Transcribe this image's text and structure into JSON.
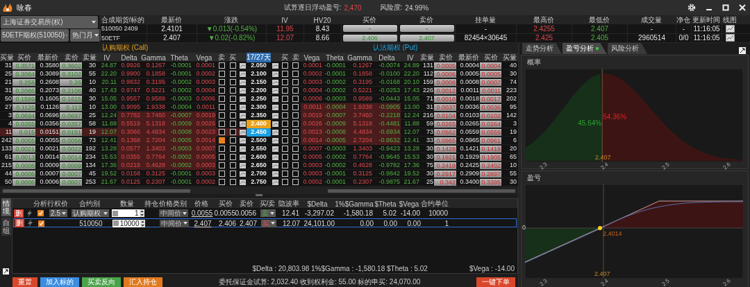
{
  "title_bar": {
    "app_name": "咏春",
    "pnl_label": "试算逐日浮动盈亏:",
    "pnl_value": "2,470",
    "risk_label": "风险度:",
    "risk_value": "24.99%"
  },
  "selectors": {
    "exchange": "上海证券交易所(权)",
    "product": "50ETF期权(510050)",
    "month": "热门月"
  },
  "quote": {
    "columns": [
      "合成期货/标的",
      "最新价",
      "涨跌",
      "IV",
      "HV20",
      "买价",
      "卖价",
      "挂单量",
      "最高价",
      "最低价",
      "成交量",
      "净仓",
      "更新时间",
      "线图"
    ],
    "rows": [
      {
        "name": "510050 2409",
        "last": "2.4101",
        "change": "▼0.013(-0.54%)",
        "iv": "11.95",
        "hv20": "8.43",
        "bid": "-",
        "ask": "-",
        "depth": "-",
        "high": "2.4255",
        "low": "2.407",
        "volume": "-",
        "net": "-",
        "time": "11:16:05"
      },
      {
        "name": "50ETF",
        "last": "2.407",
        "change": "▼0.02(-0.82%)",
        "iv": "12.07",
        "hv20": "8.66",
        "bid": "2.406",
        "ask": "2.407",
        "depth": "82454×30645",
        "high": "2.425",
        "low": "2.405",
        "volume": "2960514",
        "net": "0/0",
        "time": "11:16:05"
      }
    ]
  },
  "chain": {
    "call_title": "认购期权 (Call)",
    "put_title": "认沽期权 (Put)",
    "call_columns": [
      "买量",
      "买价",
      "最新价",
      "卖价",
      "卖量",
      "IV",
      "Delta",
      "Gamma",
      "Theta",
      "Vega",
      "卖",
      "买"
    ],
    "strike_column": "17/27天",
    "put_columns": [
      "买",
      "卖",
      "Vega",
      "Theta",
      "Gamma",
      "Delta",
      "IV",
      "卖量",
      "卖价",
      "最新价",
      "买价",
      "买量"
    ],
    "rows": [
      {
        "strike": "2.050",
        "atm": false,
        "selected": false,
        "call_shaded": false,
        "put_shaded": false,
        "call_sell": false,
        "call_buy": false,
        "put_buy": false,
        "put_sell": false,
        "call": [
          "31",
          "0.3571",
          "0.3580",
          "0.3602",
          "30",
          "24.87",
          "0.9926",
          "0.1267",
          "-0.0001",
          "0.0001"
        ],
        "put": [
          "0.0001",
          "-0.0001",
          "0.1267",
          "-0.0074",
          "24.89",
          "131",
          "0.0005",
          "0.0004",
          "0.0004",
          "40"
        ]
      },
      {
        "strike": "2.100",
        "atm": false,
        "selected": false,
        "call_shaded": false,
        "put_shaded": false,
        "call_sell": false,
        "call_buy": false,
        "put_buy": false,
        "put_sell": false,
        "call": [
          "25",
          "0.3084",
          "0.3089",
          "0.3102",
          "55",
          "22.20",
          "0.9900",
          "0.1858",
          "-0.0001",
          "0.0002"
        ],
        "put": [
          "0.0002",
          "-0.0001",
          "0.1858",
          "-0.0100",
          "22.20",
          "112",
          "0.0006",
          "0.0005",
          "0.0005",
          "30"
        ]
      },
      {
        "strike": "2.150",
        "atm": false,
        "selected": false,
        "call_shaded": false,
        "put_shaded": false,
        "call_sell": false,
        "call_buy": false,
        "put_buy": false,
        "put_sell": false,
        "call": [
          "21",
          "0.258",
          "0.2608",
          "0.26",
          "10",
          "20.11",
          "0.9832",
          "0.3195",
          "-0.0002",
          "0.0003"
        ],
        "put": [
          "0.0003",
          "-0.0002",
          "0.3195",
          "-0.0168",
          "20.10",
          "159",
          "0.0008",
          "0.0008",
          "0.0007",
          "74"
        ]
      },
      {
        "strike": "2.200",
        "atm": false,
        "selected": false,
        "call_shaded": false,
        "put_shaded": false,
        "call_sell": false,
        "call_buy": false,
        "put_buy": false,
        "put_sell": false,
        "call": [
          "31",
          "0.2086",
          "0.2073",
          "0.2108",
          "40",
          "17.43",
          "0.9747",
          "0.5221",
          "-0.0002",
          "0.0004"
        ],
        "put": [
          "0.0004",
          "-0.0002",
          "0.5221",
          "-0.0253",
          "17.43",
          "226",
          "0.0012",
          "0.0011",
          "0.0011",
          "223"
        ]
      },
      {
        "strike": "2.250",
        "atm": false,
        "selected": false,
        "call_shaded": false,
        "put_shaded": false,
        "call_sell": false,
        "call_buy": false,
        "put_buy": false,
        "put_sell": false,
        "call": [
          "50",
          "0.1599",
          "0.1605",
          "0.1615",
          "30",
          "15.05",
          "0.9557",
          "0.9589",
          "-0.0003",
          "0.0006"
        ],
        "put": [
          "0.0006",
          "-0.0003",
          "0.9589",
          "-0.0443",
          "15.05",
          "71",
          "0.0018",
          "0.0018",
          "0.0017",
          "202"
        ]
      },
      {
        "strike": "2.300",
        "atm": false,
        "selected": false,
        "call_shaded": false,
        "put_shaded": true,
        "call_sell": false,
        "call_buy": false,
        "put_buy": false,
        "put_sell": false,
        "call": [
          "27",
          "0.1126",
          "0.1126",
          "0.113",
          "10",
          "13.00",
          "0.9095",
          "1.9338",
          "-0.0004",
          "0.0011"
        ],
        "put": [
          "0.0011",
          "-0.0004",
          "1.9338",
          "-0.0905",
          "13.00",
          "31",
          "0.0037",
          "0.0036",
          "0.0036",
          "95"
        ]
      },
      {
        "strike": "2.350",
        "atm": false,
        "selected": false,
        "call_shaded": true,
        "put_shaded": true,
        "call_sell": false,
        "call_buy": false,
        "put_buy": false,
        "put_sell": false,
        "call": [
          "3",
          "0.0694",
          "0.0696",
          "0.0697",
          "25",
          "12.24",
          "0.7782",
          "3.7460",
          "-0.0007",
          "0.0019"
        ],
        "put": [
          "0.0019",
          "-0.0007",
          "3.7460",
          "-0.2218",
          "12.24",
          "216",
          "0.0104",
          "0.0103",
          "0.0102",
          "142"
        ]
      },
      {
        "strike": "2.400",
        "atm": true,
        "selected": false,
        "call_shaded": true,
        "put_shaded": true,
        "call_sell": false,
        "call_buy": false,
        "put_buy": false,
        "put_sell": false,
        "call": [
          "4",
          "0.0355",
          "0.0356",
          "0.0357",
          "58",
          "11.88",
          "0.5519",
          "5.1318",
          "-0.0009",
          "0.0026"
        ],
        "put": [
          "0.0026",
          "-0.0009",
          "5.1318",
          "-0.4481",
          "11.88",
          "59",
          "0.0265",
          "0.0265",
          "0.0264",
          "3"
        ]
      },
      {
        "strike": "2.450",
        "atm": false,
        "selected": true,
        "call_shaded": true,
        "put_shaded": true,
        "call_sell": false,
        "call_buy": false,
        "put_buy": false,
        "put_sell": false,
        "call": [
          "11",
          "0.015",
          "0.0151",
          "0.0151",
          "19",
          "12.07",
          "0.3066",
          "4.4834",
          "-0.0008",
          "0.0023"
        ],
        "put": [
          "0.0023",
          "-0.0008",
          "4.4834",
          "-0.6934",
          "12.07",
          "73",
          "0.0562",
          "0.0559",
          "0.0559",
          "19"
        ]
      },
      {
        "strike": "2.500",
        "atm": false,
        "selected": false,
        "call_shaded": true,
        "put_shaded": true,
        "call_sell": true,
        "call_buy": false,
        "put_buy": false,
        "put_sell": false,
        "call": [
          "242",
          "0.0055",
          "0.0055",
          "0.0056",
          "73",
          "12.41",
          "0.1368",
          "2.7204",
          "-0.0005",
          "0.0014"
        ],
        "put": [
          "0.0014",
          "-0.0005",
          "2.7204",
          "-0.8632",
          "12.41",
          "33",
          "0.0965",
          "0.0965",
          "0.0961",
          "6"
        ]
      },
      {
        "strike": "2.550",
        "atm": false,
        "selected": false,
        "call_shaded": true,
        "put_shaded": false,
        "call_sell": false,
        "call_buy": false,
        "put_buy": false,
        "put_sell": false,
        "call": [
          "133",
          "0.0021",
          "0.0021",
          "0.0022",
          "192",
          "13.28",
          "0.0577",
          "1.3403",
          "-0.0003",
          "0.0007"
        ],
        "put": [
          "0.0007",
          "-0.0003",
          "1.3403",
          "-0.9423",
          "13.28",
          "30",
          "0.1428",
          "0.1421",
          "0.1418",
          "20"
        ]
      },
      {
        "strike": "2.600",
        "atm": false,
        "selected": false,
        "call_shaded": true,
        "put_shaded": false,
        "call_sell": false,
        "call_buy": false,
        "put_buy": false,
        "put_sell": false,
        "call": [
          "61",
          "0.0013",
          "0.0014",
          "0.0014",
          "234",
          "15.53",
          "0.0355",
          "0.7764",
          "-0.0002",
          "0.0005"
        ],
        "put": [
          "0.0005",
          "-0.0002",
          "0.7764",
          "-0.9645",
          "15.53",
          "30",
          "0.1921",
          "0.1929",
          "0.1905",
          "65"
        ]
      },
      {
        "strike": "2.650",
        "atm": false,
        "selected": false,
        "call_shaded": true,
        "put_shaded": false,
        "call_sell": false,
        "call_buy": false,
        "put_buy": false,
        "put_sell": false,
        "call": [
          "215",
          "0.0008",
          "0.0009",
          "0.0009",
          "134",
          "17.36",
          "0.0218",
          "0.4628",
          "-0.0002",
          "0.0003"
        ],
        "put": [
          "0.0003",
          "-0.0002",
          "0.4628",
          "-0.9782",
          "17.36",
          "75",
          "0.2419",
          "0.2425",
          "0.2402",
          "10"
        ]
      },
      {
        "strike": "2.700",
        "atm": false,
        "selected": false,
        "call_shaded": false,
        "put_shaded": false,
        "call_sell": false,
        "call_buy": false,
        "put_buy": false,
        "put_sell": false,
        "call": [
          "44",
          "0.0006",
          "0.0007",
          "0.0007",
          "45",
          "19.52",
          "0.0158",
          "0.3125",
          "-0.0001",
          "0.0003"
        ],
        "put": [
          "0.0003",
          "-0.0001",
          "0.3125",
          "-0.9842",
          "19.52",
          "30",
          "0.2917",
          "0.2909",
          "0.2897",
          "55"
        ]
      },
      {
        "strike": "2.750",
        "atm": false,
        "selected": false,
        "call_shaded": false,
        "put_shaded": false,
        "call_sell": false,
        "call_buy": false,
        "put_buy": false,
        "put_sell": false,
        "call": [
          "50",
          "0.0006",
          "0.0006",
          "0.0007",
          "253",
          "21.67",
          "0.0125",
          "0.2307",
          "-0.0001",
          "0.0002"
        ],
        "put": [
          "0.0002",
          "-0.0001",
          "0.2307",
          "-0.9875",
          "21.67",
          "25",
          "0.342",
          "0.3400",
          "0.3395",
          "30"
        ]
      }
    ]
  },
  "orders": {
    "side_tabs": [
      {
        "label": "情境",
        "selected": true
      },
      {
        "label": "自组",
        "selected": false
      }
    ],
    "columns": [
      "分析",
      "行权价",
      "合约别",
      "数量",
      "持仓",
      "价格类别",
      "价格",
      "买价",
      "卖价",
      "买/卖",
      "隐波率",
      "$Delta",
      "1%$Gamma",
      "$Theta",
      "$Vega",
      "合约单位"
    ],
    "rows": [
      {
        "kind": "option",
        "selected": false,
        "delete": "删",
        "analyze": true,
        "strike": "2.5",
        "contract": "认购期权",
        "qty": "1",
        "price_type": "中间价",
        "price": "0.0055",
        "bid": "0.0055",
        "ask": "0.0056",
        "side": "卖",
        "side_sell": true,
        "iv": "12.41",
        "delta": "-3,297.02",
        "gamma": "-1,580.18",
        "theta": "5.02",
        "vega": "-14.00",
        "unit": "10000"
      },
      {
        "kind": "underlying",
        "selected": true,
        "delete": "删",
        "analyze": true,
        "contract": "510050",
        "qty": "10000",
        "price_type": "中间价",
        "price": "2.407",
        "bid": "2.406",
        "ask": "2.407",
        "side": "买",
        "side_sell": false,
        "iv": "12.07",
        "delta": "24,101.00",
        "gamma": "0.00",
        "theta": "0.00",
        "vega": "0.00",
        "unit": "1"
      }
    ],
    "summary": "$Delta : 20,803.98 1%$Gamma : -1,580.18 $Theta : 5.02",
    "summary_vega": "$Vega : -14.00",
    "buttons": [
      {
        "label": "重置",
        "color": "#d9472b"
      },
      {
        "label": "加入标的",
        "color": "#3b8de0"
      },
      {
        "label": "买卖反向",
        "color": "#4aa34a"
      },
      {
        "label": "汇入持仓",
        "color": "#e07a1f"
      }
    ],
    "margin_text": "委托保证金试算: 2,032.40 收到权利金: 55.00 标的申买: 24,070.00",
    "submit": "一键下单"
  },
  "analysis": {
    "tabs": [
      {
        "label": "走势分析",
        "selected": false,
        "indicator": false
      },
      {
        "label": "盈亏分析",
        "selected": true,
        "indicator": true
      },
      {
        "label": "风险分析",
        "selected": false,
        "indicator": false
      }
    ],
    "probability": {
      "title": "概率",
      "left_share": "45.64%",
      "right_share": "54.36%",
      "price_marker": "2.407",
      "x_ticks": [
        "2.3",
        "2.4",
        "2.5",
        "2.6"
      ]
    },
    "pnl": {
      "title": "盈亏",
      "zero_label": "0",
      "breakeven": "2.4014",
      "price_marker": "2.407",
      "x_ticks": [
        "2.3",
        "2.4",
        "2.5",
        "2.6"
      ]
    }
  }
}
